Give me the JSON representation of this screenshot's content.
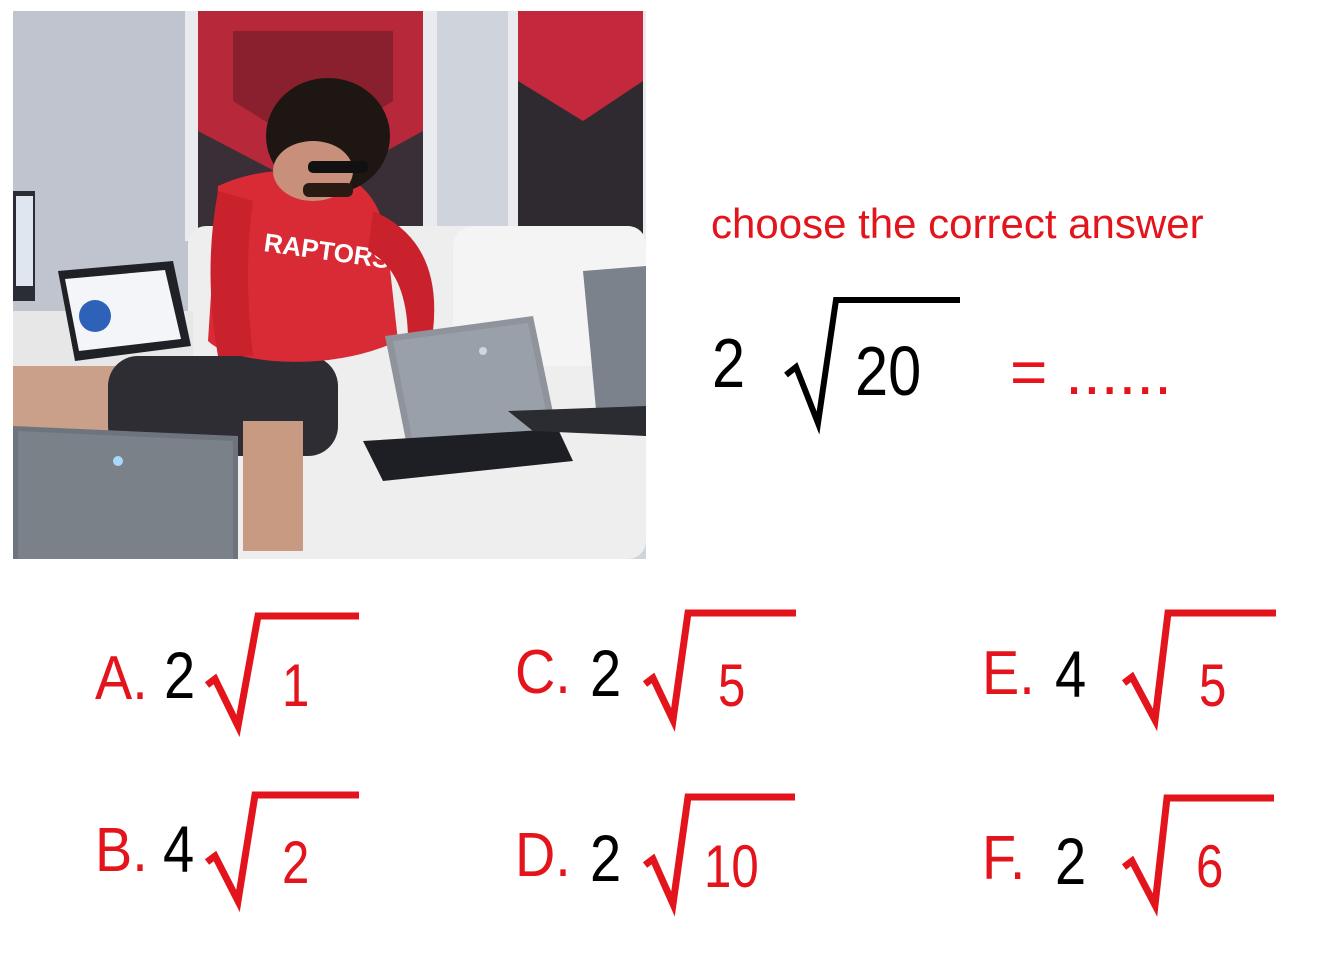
{
  "instruction": "choose the correct answer",
  "question": {
    "coefficient": "2",
    "radicand": "20",
    "equals": "= ......"
  },
  "photo": {
    "shirt_text": "RAPTORS"
  },
  "options": [
    {
      "letter": "A.",
      "coefficient": "2",
      "radicand": "1"
    },
    {
      "letter": "B.",
      "coefficient": "4",
      "radicand": "2"
    },
    {
      "letter": "C.",
      "coefficient": "2",
      "radicand": "5"
    },
    {
      "letter": "D.",
      "coefficient": "2",
      "radicand": "10"
    },
    {
      "letter": "E.",
      "coefficient": "4",
      "radicand": "5"
    },
    {
      "letter": "F.",
      "coefficient": "2",
      "radicand": "6"
    }
  ],
  "colors": {
    "accent": "#e3141b",
    "text": "#000000"
  }
}
